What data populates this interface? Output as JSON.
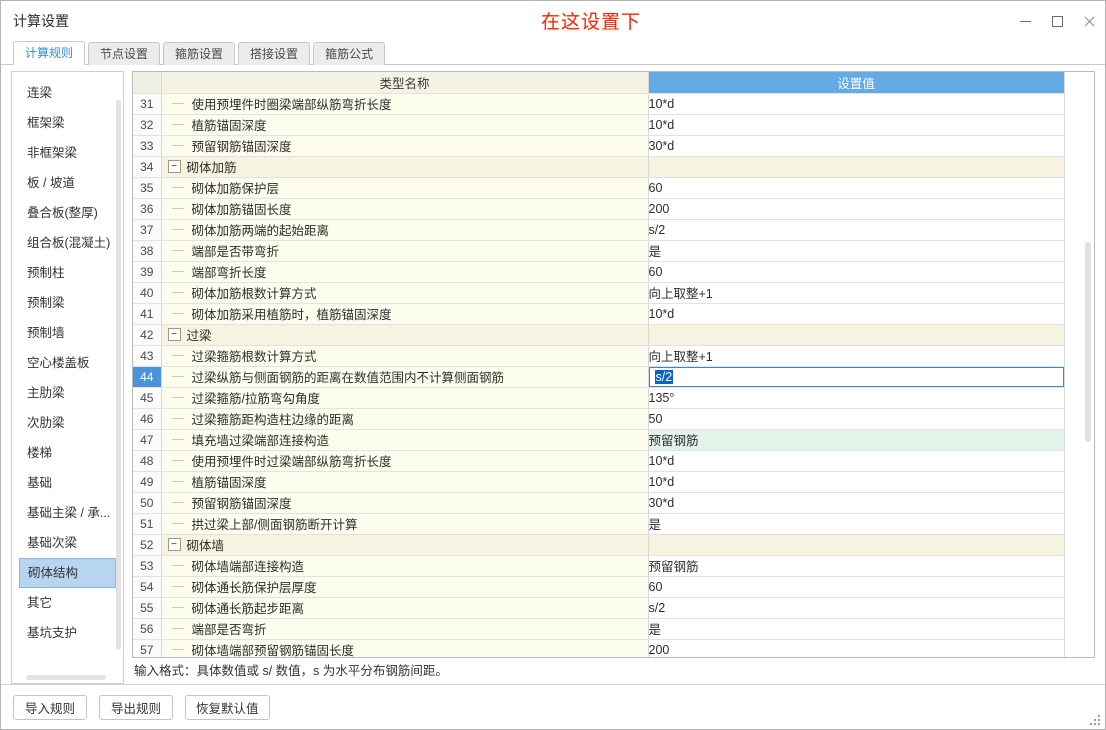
{
  "window": {
    "title": "计算设置",
    "annotation": "在这设置下",
    "minimize_icon": "minimize-icon",
    "maximize_icon": "maximize-icon",
    "close_icon": "close-icon"
  },
  "tabs": [
    {
      "label": "计算规则",
      "active": true
    },
    {
      "label": "节点设置",
      "active": false
    },
    {
      "label": "箍筋设置",
      "active": false
    },
    {
      "label": "搭接设置",
      "active": false
    },
    {
      "label": "箍筋公式",
      "active": false
    }
  ],
  "sidebar": {
    "items": [
      {
        "label": "连梁"
      },
      {
        "label": "框架梁"
      },
      {
        "label": "非框架梁"
      },
      {
        "label": "板 / 坡道"
      },
      {
        "label": "叠合板(整厚)"
      },
      {
        "label": "组合板(混凝土)"
      },
      {
        "label": "预制柱"
      },
      {
        "label": "预制梁"
      },
      {
        "label": "预制墙"
      },
      {
        "label": "空心楼盖板"
      },
      {
        "label": "主肋梁"
      },
      {
        "label": "次肋梁"
      },
      {
        "label": "楼梯"
      },
      {
        "label": "基础"
      },
      {
        "label": "基础主梁 / 承..."
      },
      {
        "label": "基础次梁"
      },
      {
        "label": "砌体结构",
        "active": true
      },
      {
        "label": "其它"
      },
      {
        "label": "基坑支护"
      }
    ]
  },
  "table": {
    "headers": {
      "num": "",
      "name": "类型名称",
      "value": "设置值"
    },
    "rows": [
      {
        "num": "31",
        "name": "使用预埋件时圈梁端部纵筋弯折长度",
        "value": "10*d",
        "kind": "item"
      },
      {
        "num": "32",
        "name": "植筋锚固深度",
        "value": "10*d",
        "kind": "item"
      },
      {
        "num": "33",
        "name": "预留钢筋锚固深度",
        "value": "30*d",
        "kind": "item"
      },
      {
        "num": "34",
        "name": "砌体加筋",
        "value": "",
        "kind": "group",
        "expander": "−"
      },
      {
        "num": "35",
        "name": "砌体加筋保护层",
        "value": "60",
        "kind": "item"
      },
      {
        "num": "36",
        "name": "砌体加筋锚固长度",
        "value": "200",
        "kind": "item"
      },
      {
        "num": "37",
        "name": "砌体加筋两端的起始距离",
        "value": "s/2",
        "kind": "item"
      },
      {
        "num": "38",
        "name": "端部是否带弯折",
        "value": "是",
        "kind": "item"
      },
      {
        "num": "39",
        "name": "端部弯折长度",
        "value": "60",
        "kind": "item"
      },
      {
        "num": "40",
        "name": "砌体加筋根数计算方式",
        "value": "向上取整+1",
        "kind": "item"
      },
      {
        "num": "41",
        "name": "砌体加筋采用植筋时，植筋锚固深度",
        "value": "10*d",
        "kind": "item"
      },
      {
        "num": "42",
        "name": "过梁",
        "value": "",
        "kind": "group",
        "expander": "−"
      },
      {
        "num": "43",
        "name": "过梁箍筋根数计算方式",
        "value": "向上取整+1",
        "kind": "item"
      },
      {
        "num": "44",
        "name": "过梁纵筋与侧面钢筋的距离在数值范围内不计算侧面钢筋",
        "value": "s/2",
        "kind": "item",
        "state": "editing"
      },
      {
        "num": "45",
        "name": "过梁箍筋/拉筋弯勾角度",
        "value": "135°",
        "kind": "item"
      },
      {
        "num": "46",
        "name": "过梁箍筋距构造柱边缘的距离",
        "value": "50",
        "kind": "item"
      },
      {
        "num": "47",
        "name": "填充墙过梁端部连接构造",
        "value": "预留钢筋",
        "kind": "item",
        "state": "changed"
      },
      {
        "num": "48",
        "name": "使用预埋件时过梁端部纵筋弯折长度",
        "value": "10*d",
        "kind": "item"
      },
      {
        "num": "49",
        "name": "植筋锚固深度",
        "value": "10*d",
        "kind": "item"
      },
      {
        "num": "50",
        "name": "预留钢筋锚固深度",
        "value": "30*d",
        "kind": "item"
      },
      {
        "num": "51",
        "name": "拱过梁上部/侧面钢筋断开计算",
        "value": "是",
        "kind": "item"
      },
      {
        "num": "52",
        "name": "砌体墙",
        "value": "",
        "kind": "group",
        "expander": "−"
      },
      {
        "num": "53",
        "name": "砌体墙端部连接构造",
        "value": "预留钢筋",
        "kind": "item"
      },
      {
        "num": "54",
        "name": "砌体通长筋保护层厚度",
        "value": "60",
        "kind": "item"
      },
      {
        "num": "55",
        "name": "砌体通长筋起步距离",
        "value": "s/2",
        "kind": "item"
      },
      {
        "num": "56",
        "name": "端部是否弯折",
        "value": "是",
        "kind": "item"
      },
      {
        "num": "57",
        "name": "砌体墙端部预留钢筋锚固长度",
        "value": "200",
        "kind": "item"
      }
    ]
  },
  "hint": "输入格式：具体数值或 s/ 数值，s 为水平分布钢筋间距。",
  "footer": {
    "buttons": [
      {
        "label": "导入规则",
        "name": "import-rules-button"
      },
      {
        "label": "导出规则",
        "name": "export-rules-button"
      },
      {
        "label": "恢复默认值",
        "name": "restore-defaults-button"
      }
    ]
  },
  "colors": {
    "accent_blue": "#64aae4",
    "selected_row": "#4a93d9",
    "changed_cell": "#e2f4e9",
    "sidebar_selected": "#b7d4f0",
    "annotation_red": "#ff2200",
    "name_column": "#fdfdee",
    "group_row": "#f6f3e0"
  }
}
